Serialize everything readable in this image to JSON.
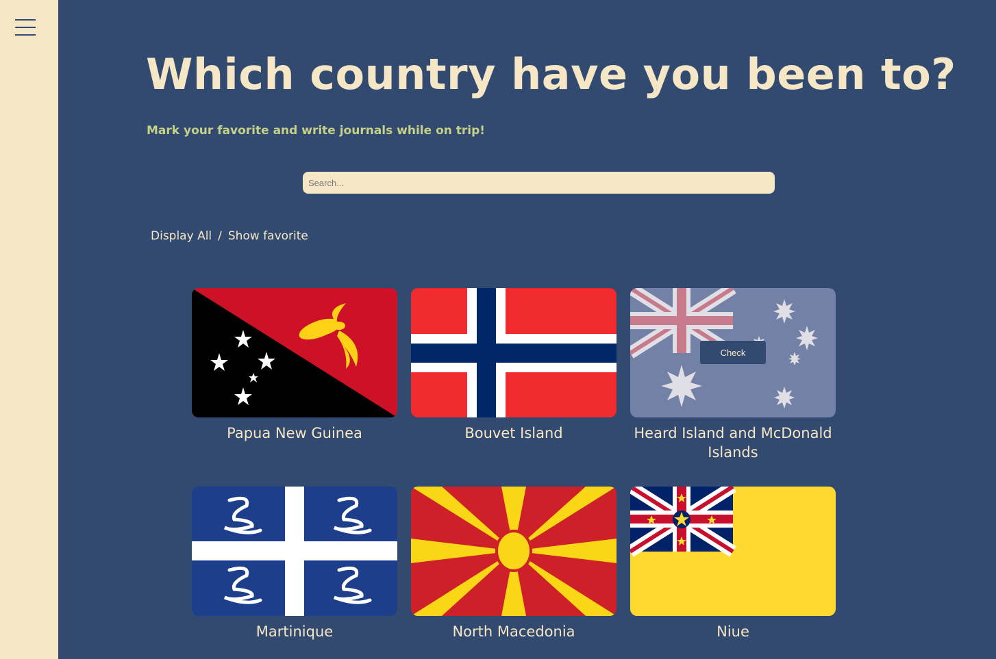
{
  "header": {
    "title": "Which country have you been to?",
    "subtitle": "Mark your favorite and write journals while on trip!"
  },
  "search": {
    "placeholder": "Search..."
  },
  "filters": {
    "display_all": "Display All",
    "separator": "/",
    "show_favorite": "Show favorite"
  },
  "countries": [
    {
      "name": "Papua New Guinea"
    },
    {
      "name": "Bouvet Island"
    },
    {
      "name": "Heard Island and McDonald Islands",
      "check_label": "Check"
    },
    {
      "name": "Martinique"
    },
    {
      "name": "North Macedonia"
    },
    {
      "name": "Niue"
    }
  ],
  "colors": {
    "background": "#324a70",
    "sidebar": "#f5e6c6",
    "title": "#f5e6c6",
    "subtitle": "#c7d287"
  },
  "icons": {
    "menu": "hamburger-menu-icon",
    "favorite": "heart-icon"
  }
}
